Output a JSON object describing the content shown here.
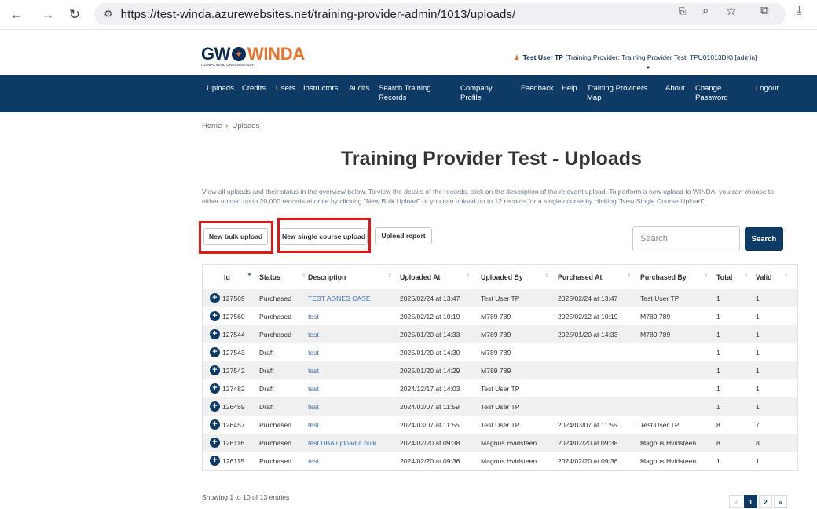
{
  "browser": {
    "url": "https://test-winda.azurewebsites.net/training-provider-admin/1013/uploads/"
  },
  "logo": {
    "gw": "GW",
    "winda": "WINDA",
    "sub": "GLOBAL WIND ORGANISATION"
  },
  "user": {
    "name": "Test User TP",
    "details": "(Training Provider: Training Provider Test, TPU01013DK) [admin]"
  },
  "nav": {
    "uploads": "Uploads",
    "credits": "Credits",
    "users": "Users",
    "instructors": "Instructors",
    "audits": "Audits",
    "search_training_records": "Search Training Records",
    "company_profile": "Company Profile",
    "feedback": "Feedback",
    "help": "Help",
    "training_providers_map": "Training Providers Map",
    "about": "About",
    "change_password": "Change Password",
    "logout": "Logout"
  },
  "breadcrumb": {
    "home": "Home",
    "current": "Uploads"
  },
  "page_title": "Training Provider Test - Uploads",
  "intro": "View all uploads and their status in the overview below. To view the details of the records, click on the description of the relevant upload. To perform a new upload to WINDA, you can choose to either upload up to 20,000 records at once by clicking \"New Bulk Upload\" or you can upload up to 12 records for a single course by clicking \"New Single Course Upload\".",
  "buttons": {
    "new_bulk": "New bulk upload",
    "new_single": "New single course upload",
    "upload_report": "Upload report",
    "search": "Search"
  },
  "search": {
    "placeholder": "Search"
  },
  "table": {
    "columns": [
      "Id",
      "Status",
      "Description",
      "Uploaded At",
      "Uploaded By",
      "Purchased At",
      "Purchased By",
      "Total",
      "Valid"
    ],
    "rows": [
      {
        "id": "127569",
        "status": "Purchased",
        "desc": "TEST AGNES CASE",
        "uploaded_at": "2025/02/24 at 13:47",
        "uploaded_by": "Test User TP",
        "purchased_at": "2025/02/24 at 13:47",
        "purchased_by": "Test User TP",
        "total": "1",
        "valid": "1"
      },
      {
        "id": "127560",
        "status": "Purchased",
        "desc": "test",
        "uploaded_at": "2025/02/12 at 10:19",
        "uploaded_by": "M789 789",
        "purchased_at": "2025/02/12 at 10:19",
        "purchased_by": "M789 789",
        "total": "1",
        "valid": "1"
      },
      {
        "id": "127544",
        "status": "Purchased",
        "desc": "test",
        "uploaded_at": "2025/01/20 at 14:33",
        "uploaded_by": "M789 789",
        "purchased_at": "2025/01/20 at 14:33",
        "purchased_by": "M789 789",
        "total": "1",
        "valid": "1"
      },
      {
        "id": "127543",
        "status": "Draft",
        "desc": "test",
        "uploaded_at": "2025/01/20 at 14:30",
        "uploaded_by": "M789 789",
        "purchased_at": "",
        "purchased_by": "",
        "total": "1",
        "valid": "1"
      },
      {
        "id": "127542",
        "status": "Draft",
        "desc": "test",
        "uploaded_at": "2025/01/20 at 14:29",
        "uploaded_by": "M789 789",
        "purchased_at": "",
        "purchased_by": "",
        "total": "1",
        "valid": "1"
      },
      {
        "id": "127482",
        "status": "Draft",
        "desc": "test",
        "uploaded_at": "2024/12/17 at 14:03",
        "uploaded_by": "Test User TP",
        "purchased_at": "",
        "purchased_by": "",
        "total": "1",
        "valid": "1"
      },
      {
        "id": "126459",
        "status": "Draft",
        "desc": "test",
        "uploaded_at": "2024/03/07 at 11:59",
        "uploaded_by": "Test User TP",
        "purchased_at": "",
        "purchased_by": "",
        "total": "1",
        "valid": "1"
      },
      {
        "id": "126457",
        "status": "Purchased",
        "desc": "test",
        "uploaded_at": "2024/03/07 at 11:55",
        "uploaded_by": "Test User TP",
        "purchased_at": "2024/03/07 at 11:55",
        "purchased_by": "Test User TP",
        "total": "8",
        "valid": "7"
      },
      {
        "id": "126116",
        "status": "Purchased",
        "desc": "test DBA upload a bulk",
        "uploaded_at": "2024/02/20 at 09:38",
        "uploaded_by": "Magnus Hvidsteen",
        "purchased_at": "2024/02/20 at 09:38",
        "purchased_by": "Magnus Hvidsteen",
        "total": "8",
        "valid": "8"
      },
      {
        "id": "126115",
        "status": "Purchased",
        "desc": "test",
        "uploaded_at": "2024/02/20 at 09:36",
        "uploaded_by": "Magnus Hvidsteen",
        "purchased_at": "2024/02/20 at 09:36",
        "purchased_by": "Magnus Hvidsteen",
        "total": "1",
        "valid": "1"
      }
    ]
  },
  "footer": {
    "entries": "Showing 1 to 10 of 13 entries",
    "pages": [
      "«",
      "1",
      "2",
      "»"
    ]
  }
}
